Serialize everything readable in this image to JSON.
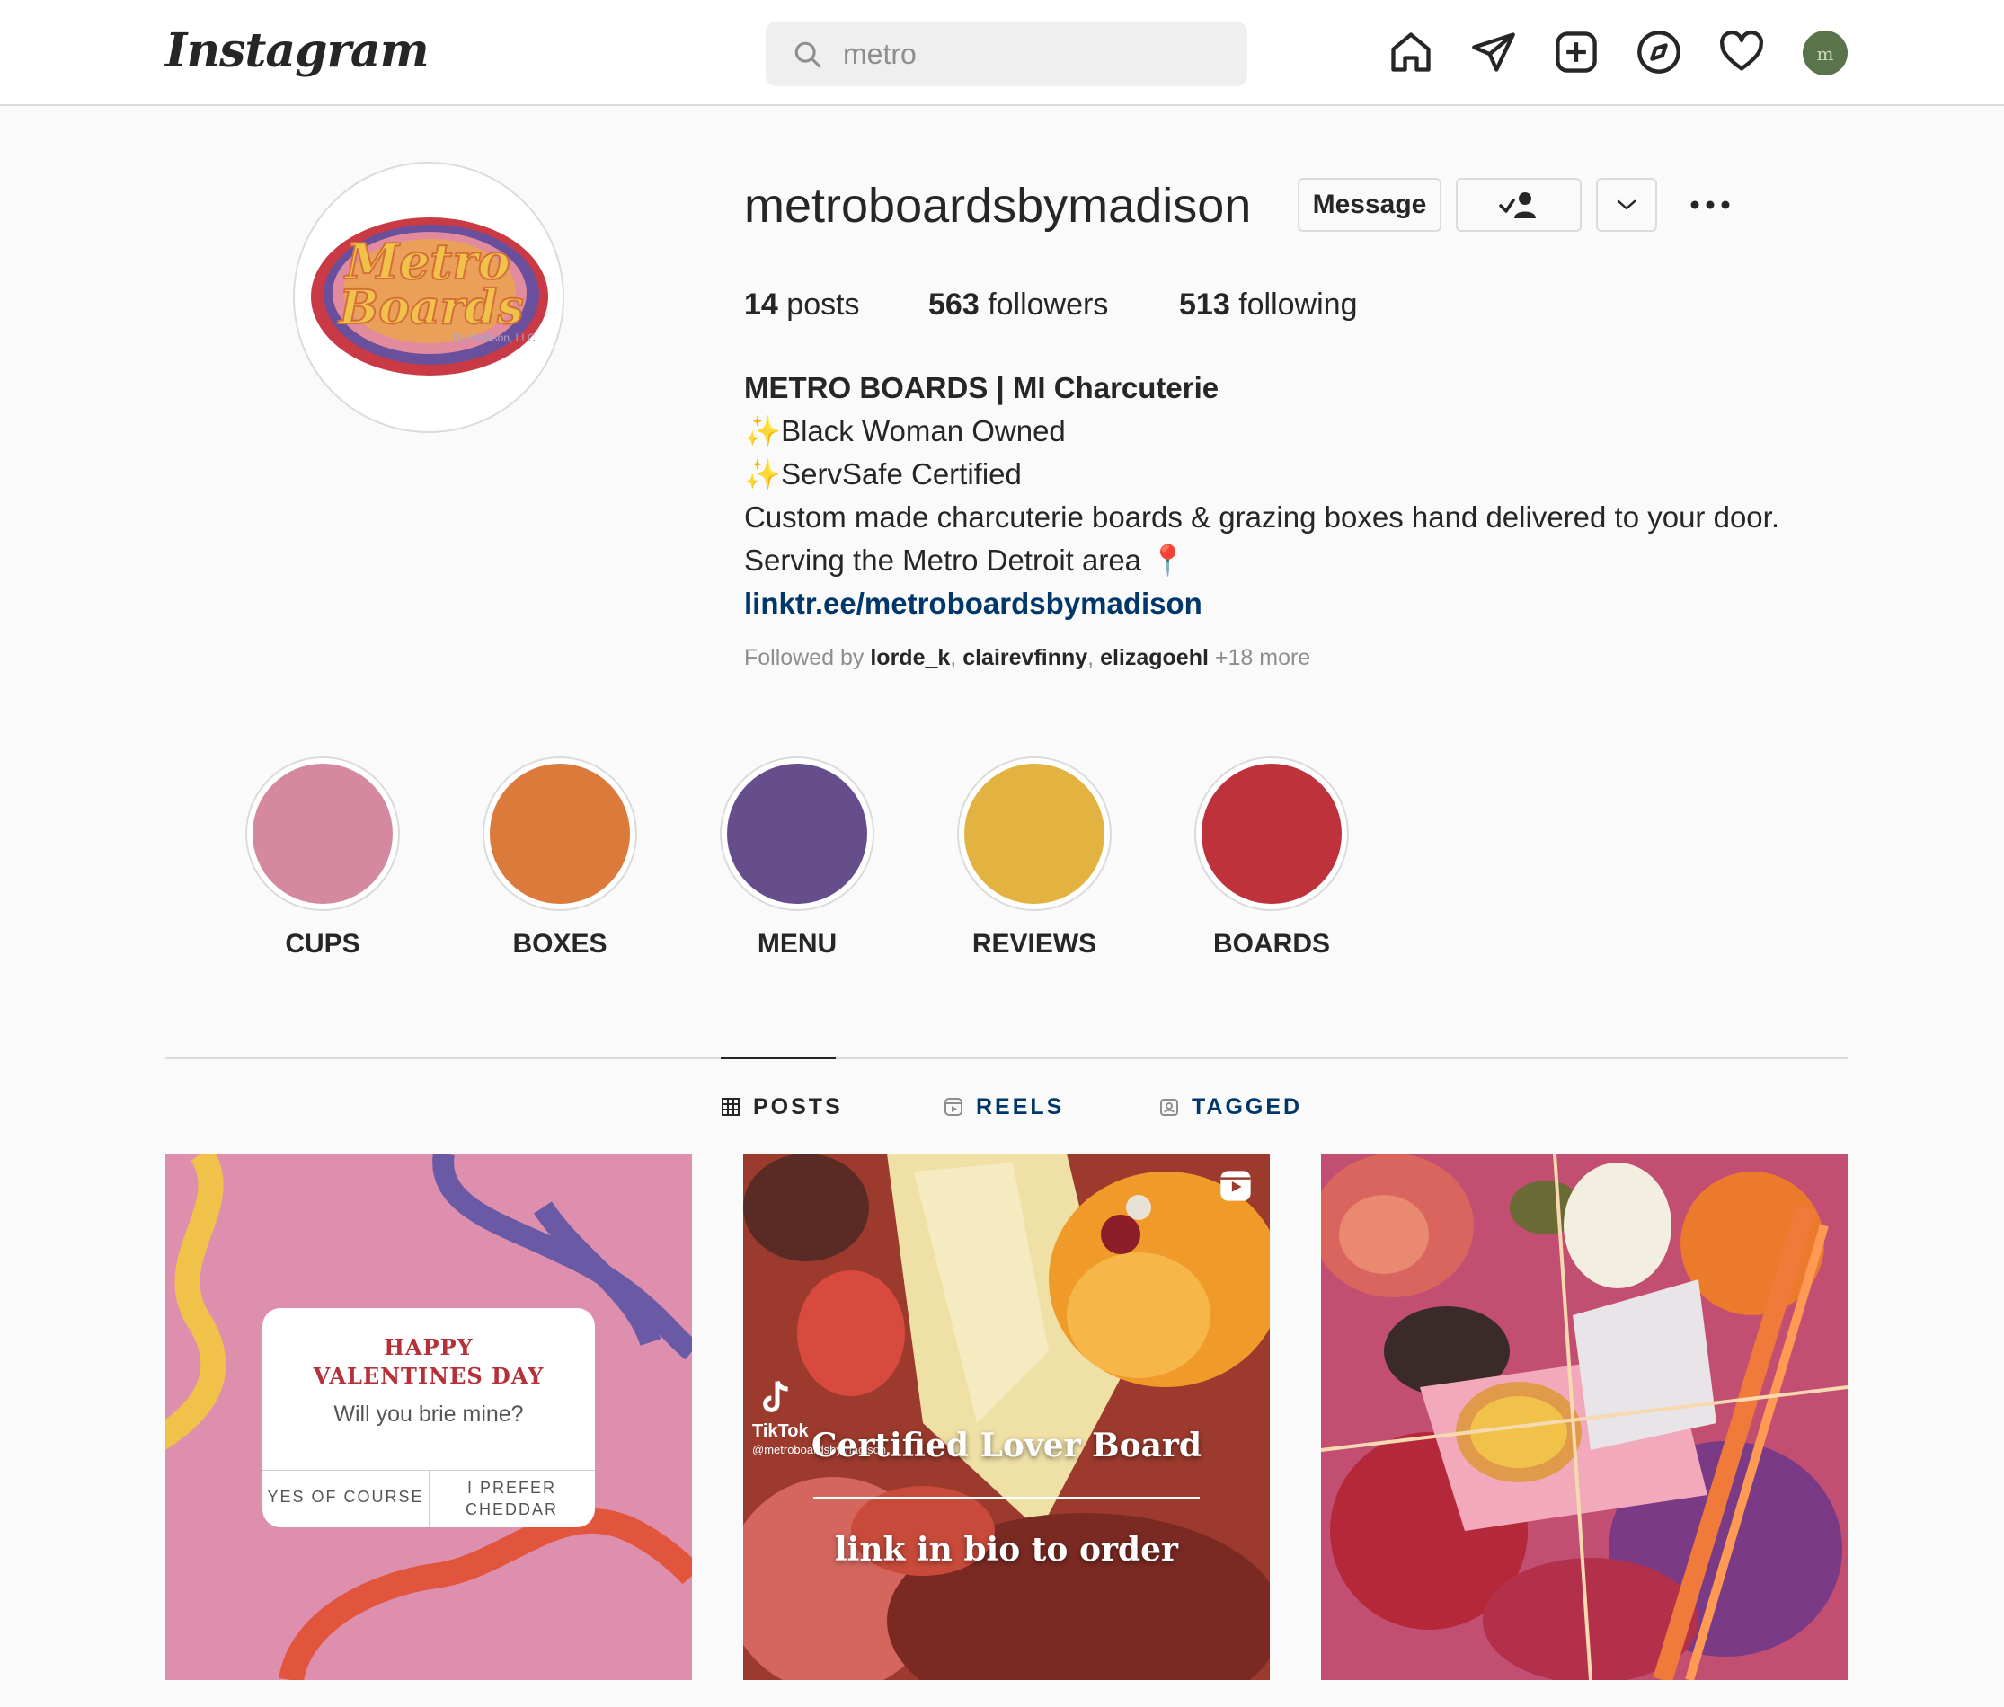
{
  "header": {
    "logo": "Instagram",
    "search_value": "metro",
    "nav_icons": [
      "home-icon",
      "direct-icon",
      "new-post-icon",
      "explore-icon",
      "activity-icon",
      "profile-avatar"
    ]
  },
  "profile": {
    "username": "metroboardsbymadison",
    "message_label": "Message",
    "stats": {
      "posts_count": "14",
      "posts_label": "posts",
      "followers_count": "563",
      "followers_label": "followers",
      "following_count": "513",
      "following_label": "following"
    },
    "bio": {
      "name": "METRO BOARDS | MI Charcuterie",
      "line1": "✨Black Woman Owned",
      "line2": "✨ServSafe Certified",
      "line3": "Custom made charcuterie boards & grazing boxes hand delivered to your door.",
      "line4": "Serving the Metro Detroit area 📍",
      "link": "linktr.ee/metroboardsbymadison"
    },
    "followed_by": {
      "prefix": "Followed by",
      "user1": "lorde_k",
      "user2": "clairevfinny",
      "user3": "elizagoehl",
      "more": "+18 more"
    },
    "logo_text": {
      "line1": "Metro",
      "line2": "Boards",
      "sub": "By Madison, LLC"
    }
  },
  "highlights": [
    {
      "label": "CUPS",
      "color": "#d5899f"
    },
    {
      "label": "BOXES",
      "color": "#dc7a3c"
    },
    {
      "label": "MENU",
      "color": "#664e8c"
    },
    {
      "label": "REVIEWS",
      "color": "#e3b342"
    },
    {
      "label": "BOARDS",
      "color": "#be323b"
    }
  ],
  "tabs": {
    "posts": "POSTS",
    "reels": "REELS",
    "tagged": "TAGGED"
  },
  "posts": {
    "post1": {
      "title_line1": "HAPPY",
      "title_line2": "VALENTINES DAY",
      "question": "Will you brie mine?",
      "option1": "YES OF COURSE",
      "option2_line1": "I PREFER",
      "option2_line2": "CHEDDAR"
    },
    "post2": {
      "tiktok": "TikTok",
      "tiktok_handle": "@metroboardsbymadison",
      "title": "Certified Lover Board",
      "subtitle": "link in bio to order"
    }
  }
}
